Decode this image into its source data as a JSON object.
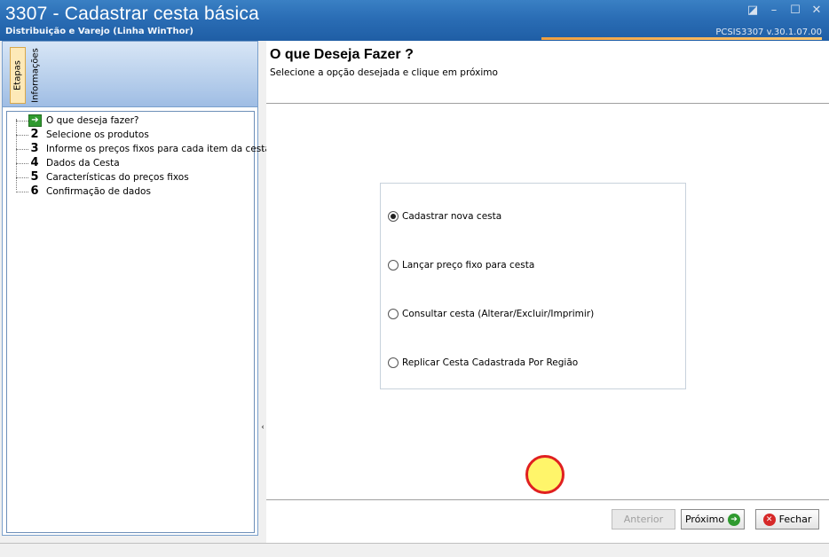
{
  "window": {
    "title": "3307 - Cadastrar cesta básica",
    "subtitle": "Distribuição e Varejo (Linha WinThor)",
    "version": "PCSIS3307  v.30.1.07.00"
  },
  "left_tabs": [
    {
      "label": "Etapas"
    },
    {
      "label": "Informações"
    }
  ],
  "steps": [
    {
      "num": "",
      "label": "O que deseja fazer?"
    },
    {
      "num": "2",
      "label": "Selecione os produtos"
    },
    {
      "num": "3",
      "label": "Informe os preços fixos para cada item da cesta"
    },
    {
      "num": "4",
      "label": "Dados da Cesta"
    },
    {
      "num": "5",
      "label": "Características do preços fixos"
    },
    {
      "num": "6",
      "label": "Confirmação de dados"
    }
  ],
  "main": {
    "heading": "O que Deseja Fazer ?",
    "subheading": "Selecione a opção desejada e clique em próximo"
  },
  "options": [
    {
      "label": "Cadastrar nova cesta",
      "checked": true
    },
    {
      "label": "Lançar preço fixo para cesta",
      "checked": false
    },
    {
      "label": "Consultar cesta (Alterar/Excluir/Imprimir)",
      "checked": false
    },
    {
      "label": "Replicar Cesta Cadastrada Por Região",
      "checked": false
    }
  ],
  "buttons": {
    "prev": "Anterior",
    "next": "Próximo",
    "close": "Fechar"
  },
  "icons": {
    "step_current": "arrow-right-icon",
    "next": "arrow-right-circle-icon",
    "close": "close-circle-icon"
  }
}
